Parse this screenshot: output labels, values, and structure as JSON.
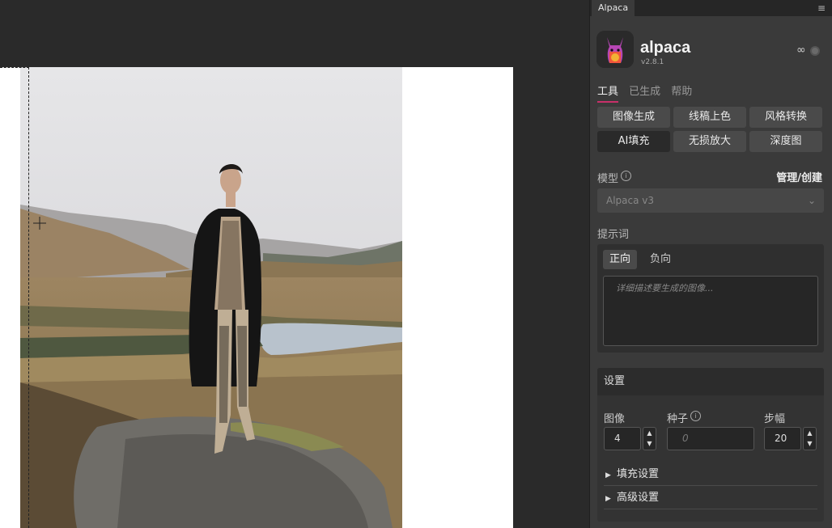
{
  "panel": {
    "tab_label": "Alpaca",
    "menu_icon": "hamburger-icon",
    "app_name": "alpaca",
    "version": "v2.8.1",
    "link_icon": "∞",
    "tabs": [
      {
        "label": "工具",
        "active": true
      },
      {
        "label": "已生成",
        "active": false
      },
      {
        "label": "帮助",
        "active": false
      }
    ],
    "tools": [
      {
        "label": "图像生成",
        "active": false
      },
      {
        "label": "线稿上色",
        "active": false
      },
      {
        "label": "风格转换",
        "active": false
      },
      {
        "label": "AI填充",
        "active": true
      },
      {
        "label": "无损放大",
        "active": false
      },
      {
        "label": "深度图",
        "active": false
      }
    ],
    "model": {
      "label": "模型",
      "manage_label": "管理/创建",
      "selected": "Alpaca v3"
    },
    "prompt": {
      "label": "提示词",
      "positive_tab": "正向",
      "negative_tab": "负向",
      "placeholder": "详细描述要生成的图像..."
    },
    "settings": {
      "title": "设置",
      "image_label": "图像",
      "image_value": "4",
      "seed_label": "种子",
      "seed_placeholder": "0",
      "steps_label": "步幅",
      "steps_value": "20",
      "fill_settings": "填充设置",
      "advanced_settings": "高级设置"
    }
  },
  "colors": {
    "accent": "#c8306a",
    "panel_bg": "#3a3a3a",
    "canvas_bg": "#2a2a2a"
  }
}
